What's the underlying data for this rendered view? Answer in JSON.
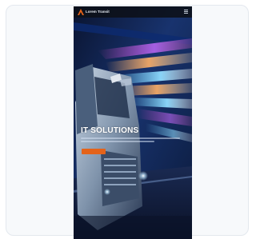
{
  "page": {
    "background": "#ffffff",
    "card_background": "#f7f9fb"
  },
  "header": {
    "logo_icon": "brand-logo-icon",
    "brand_name": "Lorem Transit",
    "menu_icon": "hamburger-menu-icon",
    "background": "#0c1018"
  },
  "hero": {
    "headline": "IT SOLUTIONS",
    "subtext": "",
    "cta_label": "",
    "cta_color": "#e4631a",
    "image_subject": "truck-light-trails-image"
  }
}
